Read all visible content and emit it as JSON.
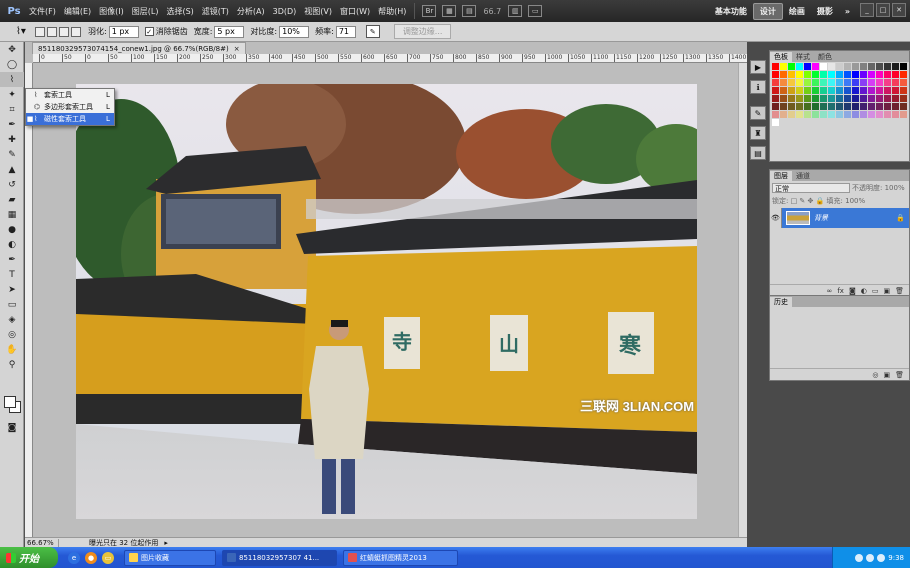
{
  "menubar": {
    "logo": "Ps",
    "items": [
      "文件(F)",
      "编辑(E)",
      "图像(I)",
      "图层(L)",
      "选择(S)",
      "滤镜(T)",
      "分析(A)",
      "3D(D)",
      "视图(V)",
      "窗口(W)",
      "帮助(H)"
    ],
    "zoom": "66.7",
    "workspaces": [
      "基本功能",
      "设计",
      "绘画",
      "摄影"
    ],
    "active_workspace": "设计",
    "more": "»"
  },
  "options": {
    "feather_label": "羽化:",
    "feather_value": "1 px",
    "antialias_label": "消除锯齿",
    "width_label": "宽度:",
    "width_value": "5 px",
    "contrast_label": "对比度:",
    "contrast_value": "10%",
    "frequency_label": "频率:",
    "frequency_value": "71",
    "refine_label": "调整边缘..."
  },
  "document": {
    "tab_title": "851180329573074154_conew1.jpg @ 66.7%(RGB/8#)",
    "zoom_status": "66.67%",
    "status_msg": "曝光只在 32 位起作用"
  },
  "flyout": {
    "items": [
      {
        "name": "套索工具",
        "key": "L",
        "selected": false
      },
      {
        "name": "多边形套索工具",
        "key": "L",
        "selected": false
      },
      {
        "name": "磁性套索工具",
        "key": "L",
        "selected": true
      }
    ]
  },
  "ruler": {
    "labels": [
      "0",
      "50",
      "0",
      "50",
      "100",
      "150",
      "200",
      "250",
      "300",
      "350",
      "400",
      "450",
      "500",
      "550",
      "600",
      "650",
      "700",
      "750",
      "800",
      "850",
      "900",
      "950",
      "1000",
      "1050",
      "1100",
      "1150",
      "1200",
      "1250",
      "1300",
      "1350",
      "1400"
    ]
  },
  "photo": {
    "wall_characters": [
      "寺",
      "山",
      "寒"
    ],
    "watermark": "三联网 3LIAN.COM"
  },
  "panels": {
    "swatch_tabs": [
      "色板",
      "样式",
      "颜色"
    ],
    "layer_tabs": [
      "图层",
      "通道"
    ],
    "blend_mode": "正常",
    "opacity_label": "不透明度: 100%",
    "lock_label": "锁定: □ ✎ ✥ 🔒  填充: 100%",
    "layer_name": "背景",
    "history_tab": "历史"
  },
  "taskbar": {
    "start": "开始",
    "tasks": [
      "图片收藏",
      "85118032957307 41...",
      "红蜻蜓抓图精灵2013"
    ],
    "active_task": 1,
    "clock": "9:38"
  },
  "colors": {
    "accent": "#3a78d6",
    "wall": "#d9a520",
    "roof": "#2e2e2e"
  }
}
